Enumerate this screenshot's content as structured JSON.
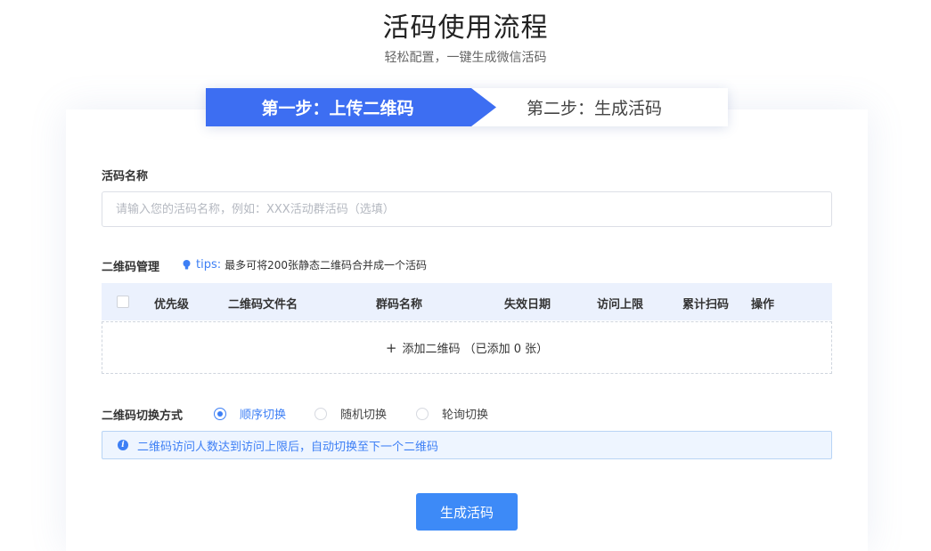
{
  "header": {
    "title": "活码使用流程",
    "subtitle": "轻松配置，一键生成微信活码"
  },
  "steps": {
    "step1": "第一步：上传二维码",
    "step2": "第二步：生成活码"
  },
  "form": {
    "name_label": "活码名称",
    "name_placeholder": "请输入您的活码名称，例如：XXX活动群活码（选填）",
    "name_value": "",
    "qr_manage_label": "二维码管理",
    "tips_word": "tips:",
    "tips_text": "最多可将200张静态二维码合并成一个活码",
    "table_headers": [
      "优先级",
      "二维码文件名",
      "群码名称",
      "失效日期",
      "访问上限",
      "累计扫码",
      "操作"
    ],
    "add_qr_plus": "+",
    "add_qr_text": "添加二维码 （已添加 0 张）",
    "switch_label": "二维码切换方式",
    "switch_options": [
      "顺序切换",
      "随机切换",
      "轮询切换"
    ],
    "switch_selected": "顺序切换",
    "info_icon": "i",
    "info_text": "二维码访问人数达到访问上限后，自动切换至下一个二维码",
    "submit_label": "生成活码"
  },
  "colors": {
    "primary": "#3d6ef2",
    "button": "#3d8af7",
    "link": "#3d7ff5",
    "table_header_bg": "#ebf1fd",
    "info_bg": "#eef5ff"
  },
  "icons": {
    "tips": "lightbulb-icon",
    "info": "info-icon",
    "add": "plus-icon"
  }
}
